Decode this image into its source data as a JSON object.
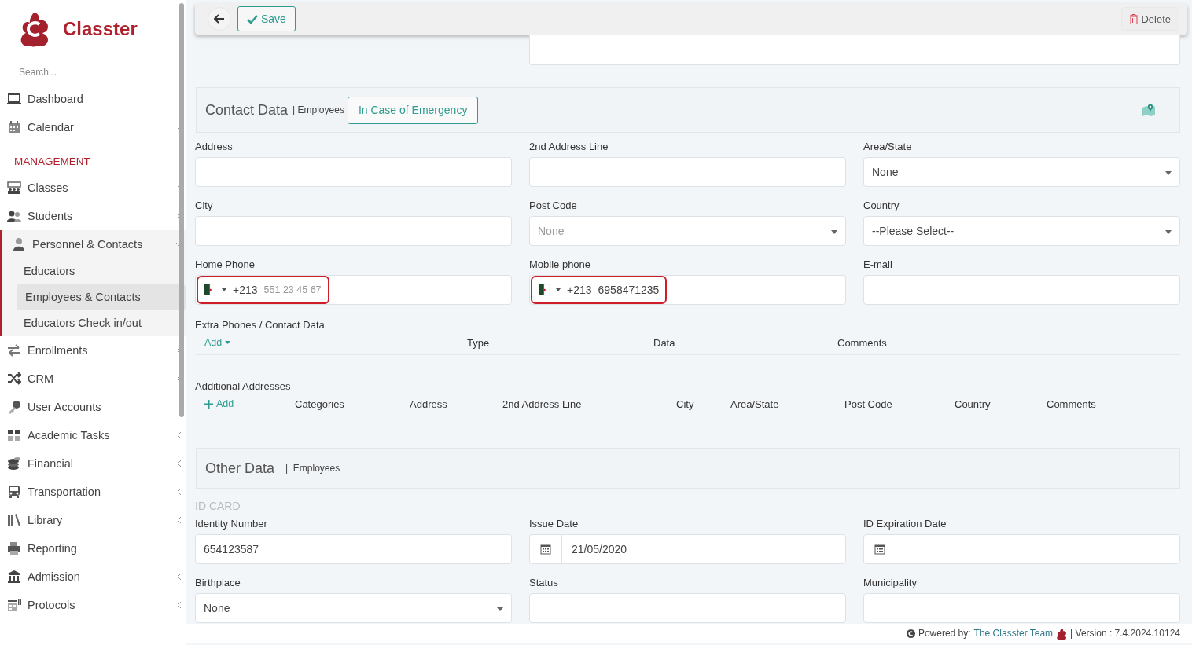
{
  "sidebar": {
    "logo_text": "Classter",
    "search": {
      "placeholder": "Search..."
    },
    "items": [
      {
        "kind": "item",
        "label": "Dashboard",
        "submenu": false,
        "expanded": false
      },
      {
        "kind": "item",
        "label": "Calendar",
        "submenu": true,
        "expanded": false
      },
      {
        "kind": "header",
        "label": "MANAGEMENT"
      },
      {
        "kind": "item",
        "label": "Classes",
        "submenu": true,
        "expanded": false
      },
      {
        "kind": "item",
        "label": "Students",
        "submenu": true,
        "expanded": false
      },
      {
        "kind": "item",
        "label": "Personnel & Contacts",
        "submenu": true,
        "expanded": true,
        "children": [
          {
            "label": "Educators",
            "selected": false
          },
          {
            "label": "Employees & Contacts",
            "selected": true
          },
          {
            "label": "Educators Check in/out",
            "selected": false
          }
        ]
      },
      {
        "kind": "item",
        "label": "Enrollments",
        "submenu": true,
        "expanded": false
      },
      {
        "kind": "item",
        "label": "CRM",
        "submenu": true,
        "expanded": false
      },
      {
        "kind": "item",
        "label": "User Accounts",
        "submenu": false,
        "expanded": false
      },
      {
        "kind": "item",
        "label": "Academic Tasks",
        "submenu": true,
        "expanded": false
      },
      {
        "kind": "item",
        "label": "Financial",
        "submenu": true,
        "expanded": false
      },
      {
        "kind": "item",
        "label": "Transportation",
        "submenu": true,
        "expanded": false
      },
      {
        "kind": "item",
        "label": "Library",
        "submenu": true,
        "expanded": false
      },
      {
        "kind": "item",
        "label": "Reporting",
        "submenu": false,
        "expanded": false
      },
      {
        "kind": "item",
        "label": "Admission",
        "submenu": true,
        "expanded": false
      },
      {
        "kind": "item",
        "label": "Protocols",
        "submenu": true,
        "expanded": false
      }
    ]
  },
  "toolbar": {
    "save_label": "Save",
    "delete_label": "Delete"
  },
  "contact": {
    "title": "Contact Data",
    "subtitle": "| Employees",
    "emergency_button": "In Case of Emergency",
    "fields": [
      {
        "kind": "text",
        "label": "Address"
      },
      {
        "kind": "text",
        "label": "2nd Address Line"
      },
      {
        "kind": "select",
        "label": "Area/State",
        "value": "None"
      },
      {
        "kind": "text",
        "label": "City"
      },
      {
        "kind": "select",
        "label": "Post Code",
        "placeholder": "None"
      },
      {
        "kind": "select",
        "label": "Country",
        "value": "--Please Select--"
      },
      {
        "kind": "phone",
        "label": "Home Phone",
        "dial_code": "+213",
        "placeholder": "551 23 45 67",
        "highlighted": true
      },
      {
        "kind": "phone",
        "label": "Mobile phone",
        "dial_code": "+213",
        "value": "6958471235",
        "highlighted": true
      },
      {
        "kind": "text",
        "label": "E-mail"
      }
    ]
  },
  "extra_phones": {
    "title": "Extra Phones / Contact Data",
    "add_label": "Add",
    "columns": [
      "Type",
      "Data",
      "Comments"
    ]
  },
  "additional_addresses": {
    "title": "Additional Addresses",
    "add_label": "Add",
    "columns": [
      "Categories",
      "Address",
      "2nd Address Line",
      "City",
      "Area/State",
      "Post Code",
      "Country",
      "Comments"
    ]
  },
  "other": {
    "title": "Other Data",
    "subtitle": "|  Employees",
    "section": "ID CARD",
    "fields": [
      {
        "kind": "text",
        "label": "Identity Number",
        "value": "654123587"
      },
      {
        "kind": "date",
        "label": "Issue Date",
        "value": "21/05/2020"
      },
      {
        "kind": "date",
        "label": "ID Expiration Date"
      },
      {
        "kind": "select",
        "label": "Birthplace",
        "value": "None"
      },
      {
        "kind": "text",
        "label": "Status"
      },
      {
        "kind": "text",
        "label": "Municipality"
      }
    ]
  },
  "footer": {
    "powered_by": "Powered by:",
    "team_link": "The Classter Team",
    "version": "| Version : 7.4.2024.10124"
  }
}
